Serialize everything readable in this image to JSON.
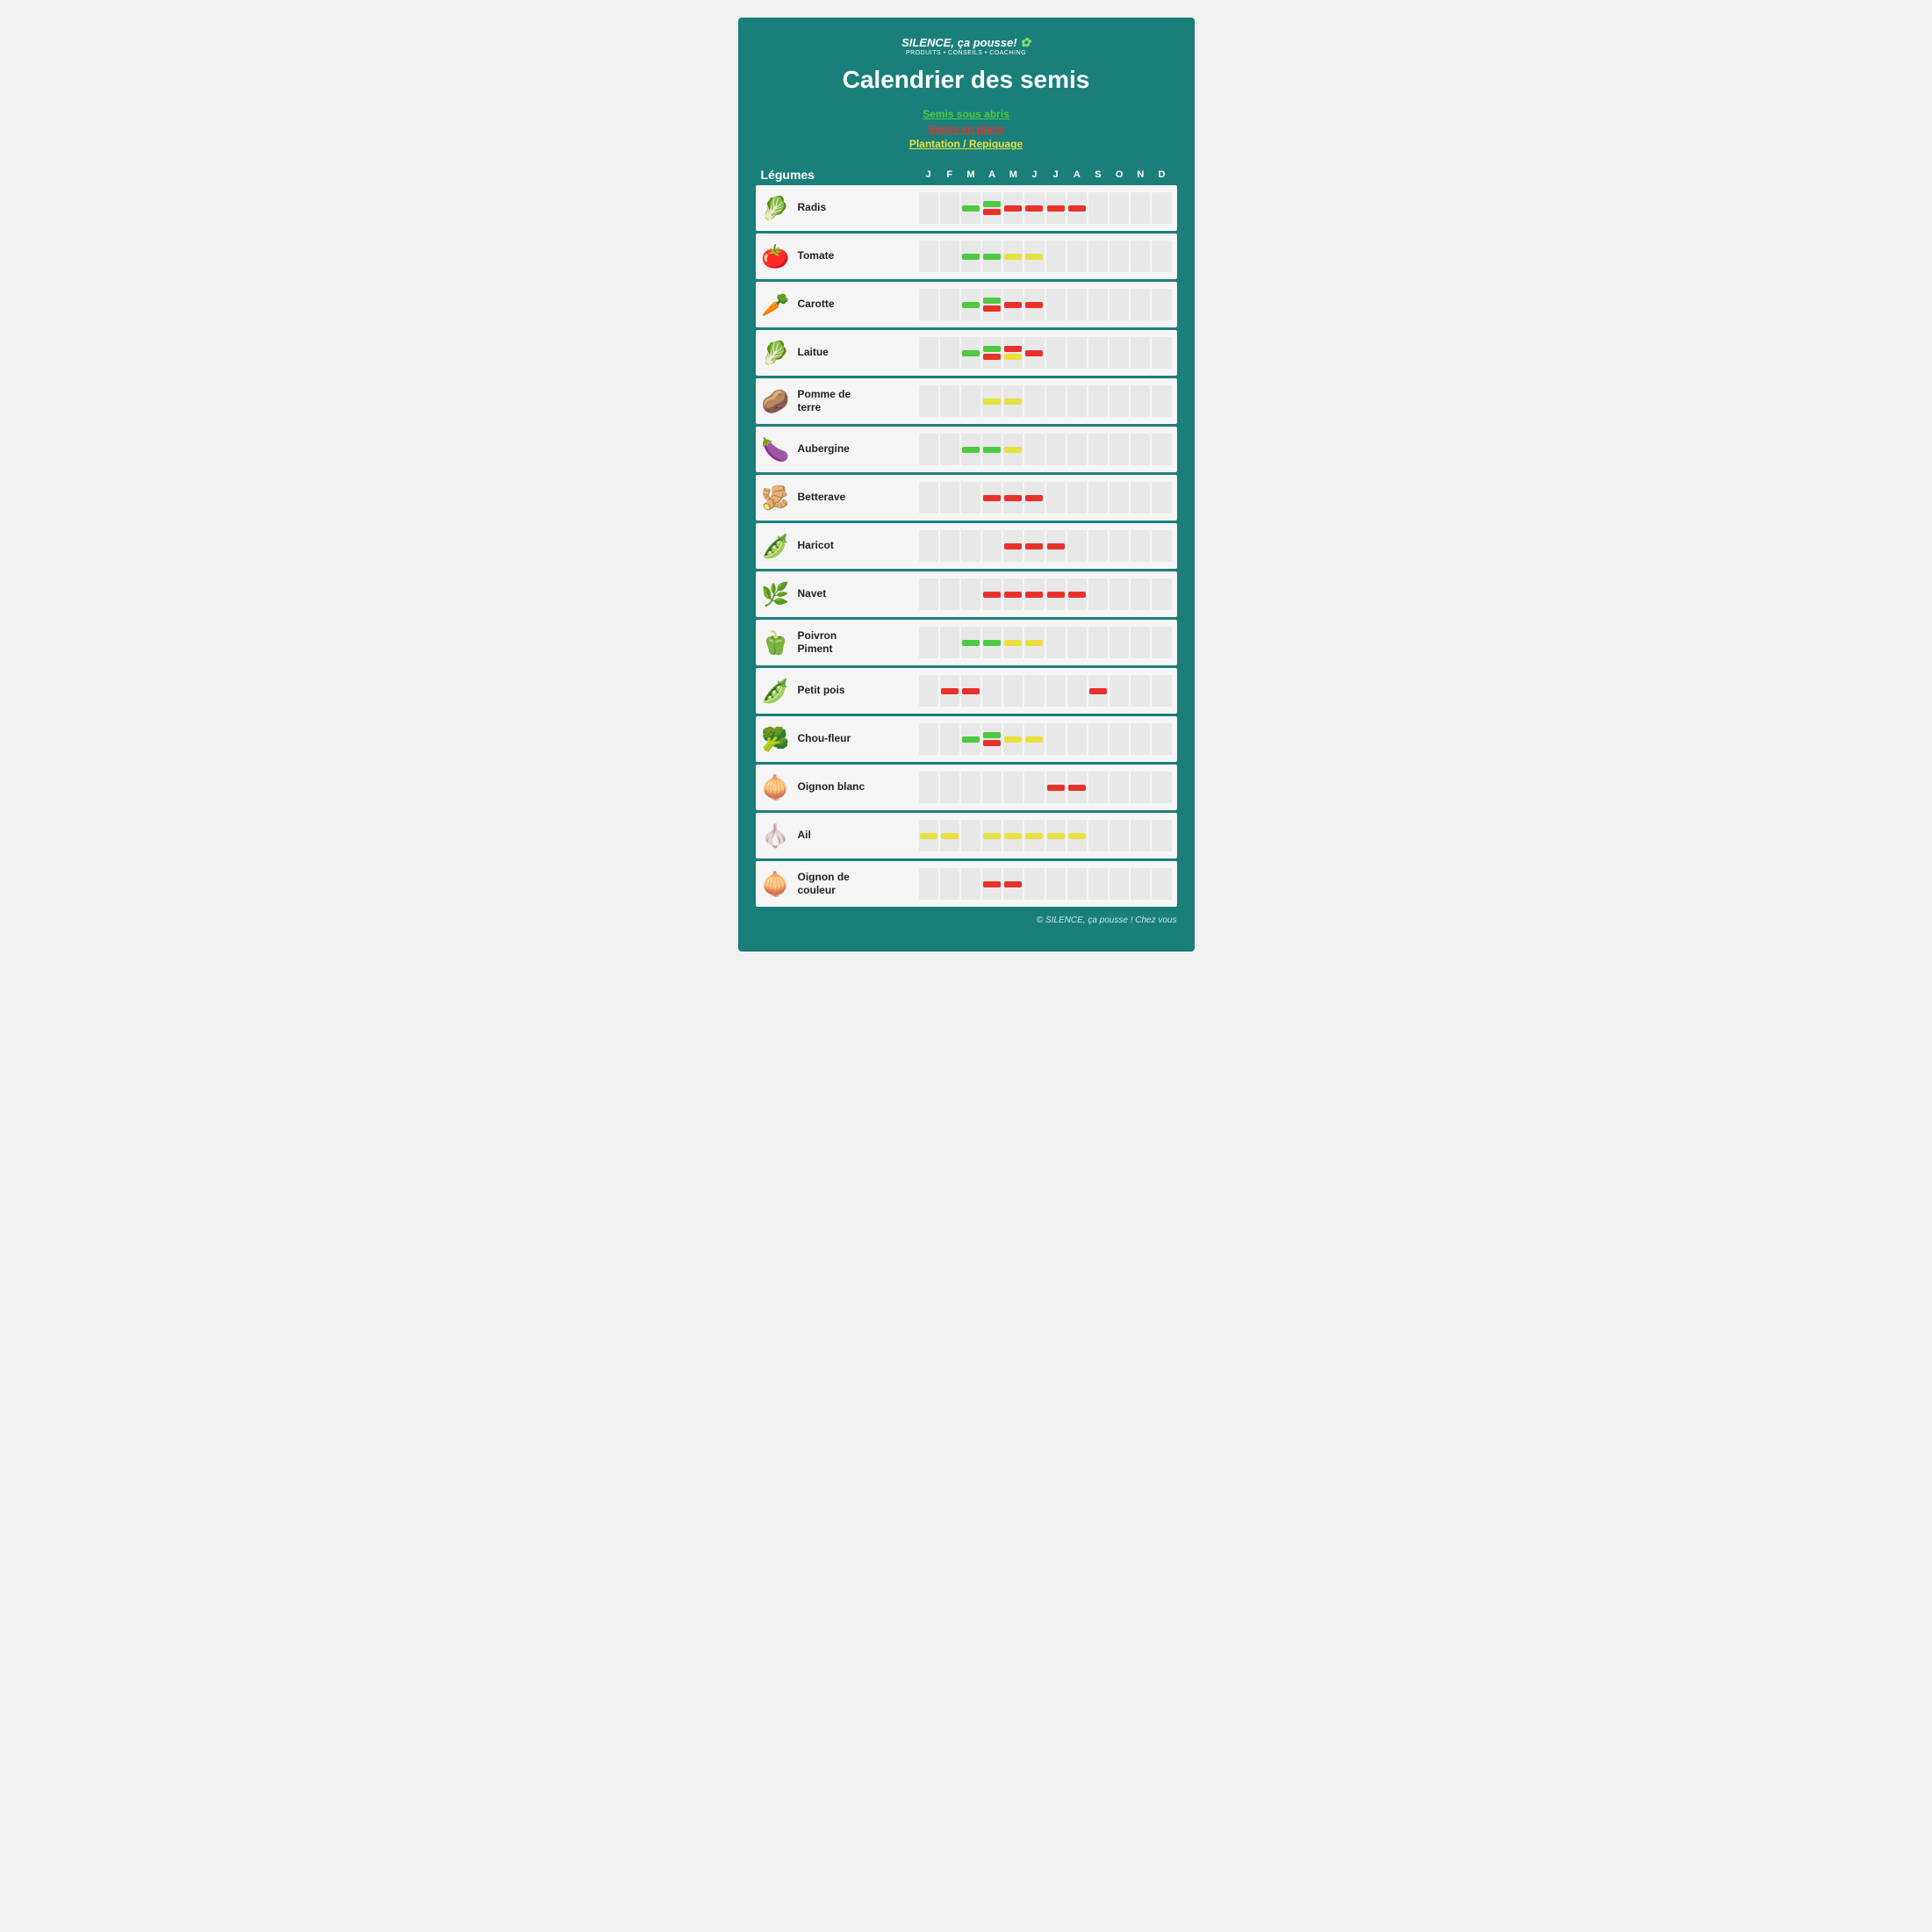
{
  "brand": {
    "name": "SILENCE, ça pousse!",
    "subtitle": "PRODUITS • CONSEILS • COACHING",
    "clover": "✿"
  },
  "title": "Calendrier des semis",
  "legend": {
    "items": [
      {
        "label": "Semis sous abris",
        "color": "green"
      },
      {
        "label": "Semis en place",
        "color": "red"
      },
      {
        "label": "Plantation / Repiquage",
        "color": "yellow"
      }
    ]
  },
  "months": [
    "J",
    "F",
    "M",
    "A",
    "M",
    "J",
    "J",
    "A",
    "S",
    "O",
    "N",
    "D"
  ],
  "vegetables": [
    {
      "name": "Radis",
      "icon": "🥬",
      "schedule": [
        {
          "month": 2,
          "bars": [
            "green"
          ]
        },
        {
          "month": 3,
          "bars": [
            "green",
            "red"
          ]
        },
        {
          "month": 4,
          "bars": [
            "red"
          ]
        },
        {
          "month": 5,
          "bars": [
            "red"
          ]
        },
        {
          "month": 6,
          "bars": [
            "red"
          ]
        },
        {
          "month": 7,
          "bars": [
            "red"
          ]
        }
      ]
    },
    {
      "name": "Tomate",
      "icon": "🍅",
      "schedule": [
        {
          "month": 2,
          "bars": [
            "green"
          ]
        },
        {
          "month": 3,
          "bars": [
            "green"
          ]
        },
        {
          "month": 4,
          "bars": [
            "yellow"
          ]
        },
        {
          "month": 5,
          "bars": [
            "yellow"
          ]
        }
      ]
    },
    {
      "name": "Carotte",
      "icon": "🥕",
      "schedule": [
        {
          "month": 2,
          "bars": [
            "green"
          ]
        },
        {
          "month": 3,
          "bars": [
            "green",
            "red"
          ]
        },
        {
          "month": 4,
          "bars": [
            "red"
          ]
        },
        {
          "month": 5,
          "bars": [
            "red"
          ]
        }
      ]
    },
    {
      "name": "Laitue",
      "icon": "🥬",
      "schedule": [
        {
          "month": 2,
          "bars": [
            "green"
          ]
        },
        {
          "month": 3,
          "bars": [
            "green",
            "red"
          ]
        },
        {
          "month": 4,
          "bars": [
            "red",
            "yellow"
          ]
        },
        {
          "month": 5,
          "bars": [
            "red"
          ]
        }
      ]
    },
    {
      "name": "Pomme de\nterre",
      "icon": "🥔",
      "schedule": [
        {
          "month": 3,
          "bars": [
            "yellow"
          ]
        },
        {
          "month": 4,
          "bars": [
            "yellow"
          ]
        }
      ]
    },
    {
      "name": "Aubergine",
      "icon": "🍆",
      "schedule": [
        {
          "month": 2,
          "bars": [
            "green"
          ]
        },
        {
          "month": 3,
          "bars": [
            "green"
          ]
        },
        {
          "month": 4,
          "bars": [
            "yellow"
          ]
        }
      ]
    },
    {
      "name": "Betterave",
      "icon": "🫚",
      "schedule": [
        {
          "month": 3,
          "bars": [
            "red"
          ]
        },
        {
          "month": 4,
          "bars": [
            "red"
          ]
        },
        {
          "month": 5,
          "bars": [
            "red"
          ]
        }
      ]
    },
    {
      "name": "Haricot",
      "icon": "🫛",
      "schedule": [
        {
          "month": 4,
          "bars": [
            "red"
          ]
        },
        {
          "month": 5,
          "bars": [
            "red"
          ]
        },
        {
          "month": 6,
          "bars": [
            "red"
          ]
        }
      ]
    },
    {
      "name": "Navet",
      "icon": "🌿",
      "schedule": [
        {
          "month": 3,
          "bars": [
            "red"
          ]
        },
        {
          "month": 4,
          "bars": [
            "red"
          ]
        },
        {
          "month": 5,
          "bars": [
            "red"
          ]
        },
        {
          "month": 6,
          "bars": [
            "red"
          ]
        },
        {
          "month": 7,
          "bars": [
            "red"
          ]
        }
      ]
    },
    {
      "name": "Poivron\nPiment",
      "icon": "🫑",
      "schedule": [
        {
          "month": 2,
          "bars": [
            "green"
          ]
        },
        {
          "month": 3,
          "bars": [
            "green"
          ]
        },
        {
          "month": 4,
          "bars": [
            "yellow"
          ]
        },
        {
          "month": 5,
          "bars": [
            "yellow"
          ]
        }
      ]
    },
    {
      "name": "Petit pois",
      "icon": "🫛",
      "schedule": [
        {
          "month": 1,
          "bars": [
            "red"
          ]
        },
        {
          "month": 2,
          "bars": [
            "red"
          ]
        },
        {
          "month": 8,
          "bars": [
            "red"
          ]
        }
      ]
    },
    {
      "name": "Chou-fleur",
      "icon": "🥦",
      "schedule": [
        {
          "month": 2,
          "bars": [
            "green"
          ]
        },
        {
          "month": 3,
          "bars": [
            "green",
            "red"
          ]
        },
        {
          "month": 4,
          "bars": [
            "yellow"
          ]
        },
        {
          "month": 5,
          "bars": [
            "yellow"
          ]
        }
      ]
    },
    {
      "name": "Oignon blanc",
      "icon": "🧅",
      "schedule": [
        {
          "month": 6,
          "bars": [
            "red"
          ]
        },
        {
          "month": 7,
          "bars": [
            "red"
          ]
        }
      ]
    },
    {
      "name": "Ail",
      "icon": "🧄",
      "schedule": [
        {
          "month": 0,
          "bars": [
            "yellow"
          ]
        },
        {
          "month": 1,
          "bars": [
            "yellow"
          ]
        },
        {
          "month": 3,
          "bars": [
            "yellow"
          ]
        },
        {
          "month": 4,
          "bars": [
            "yellow"
          ]
        },
        {
          "month": 5,
          "bars": [
            "yellow"
          ]
        },
        {
          "month": 6,
          "bars": [
            "yellow"
          ]
        },
        {
          "month": 7,
          "bars": [
            "yellow"
          ]
        }
      ]
    },
    {
      "name": "Oignon de\ncouleur",
      "icon": "🧅",
      "schedule": [
        {
          "month": 3,
          "bars": [
            "red"
          ]
        },
        {
          "month": 4,
          "bars": [
            "red"
          ]
        }
      ]
    }
  ],
  "footer": "© SILENCE, ça pousse ! Chez vous"
}
